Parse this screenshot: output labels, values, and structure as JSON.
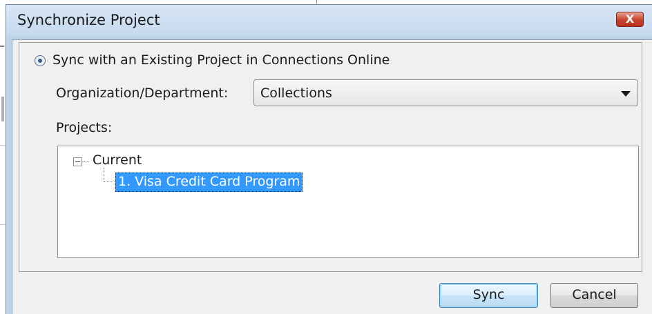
{
  "window": {
    "title": "Synchronize Project",
    "close_label": "X"
  },
  "sync_option": {
    "label": "Sync with an Existing Project in Connections Online",
    "selected": true
  },
  "organization": {
    "label": "Organization/Department:",
    "value": "Collections"
  },
  "projects": {
    "label": "Projects:",
    "tree": {
      "root": "Current",
      "expanded": true,
      "children": [
        "1. Visa Credit Card Program"
      ],
      "selected_child": "1. Visa Credit Card Program"
    }
  },
  "buttons": {
    "sync": "Sync",
    "cancel": "Cancel"
  }
}
